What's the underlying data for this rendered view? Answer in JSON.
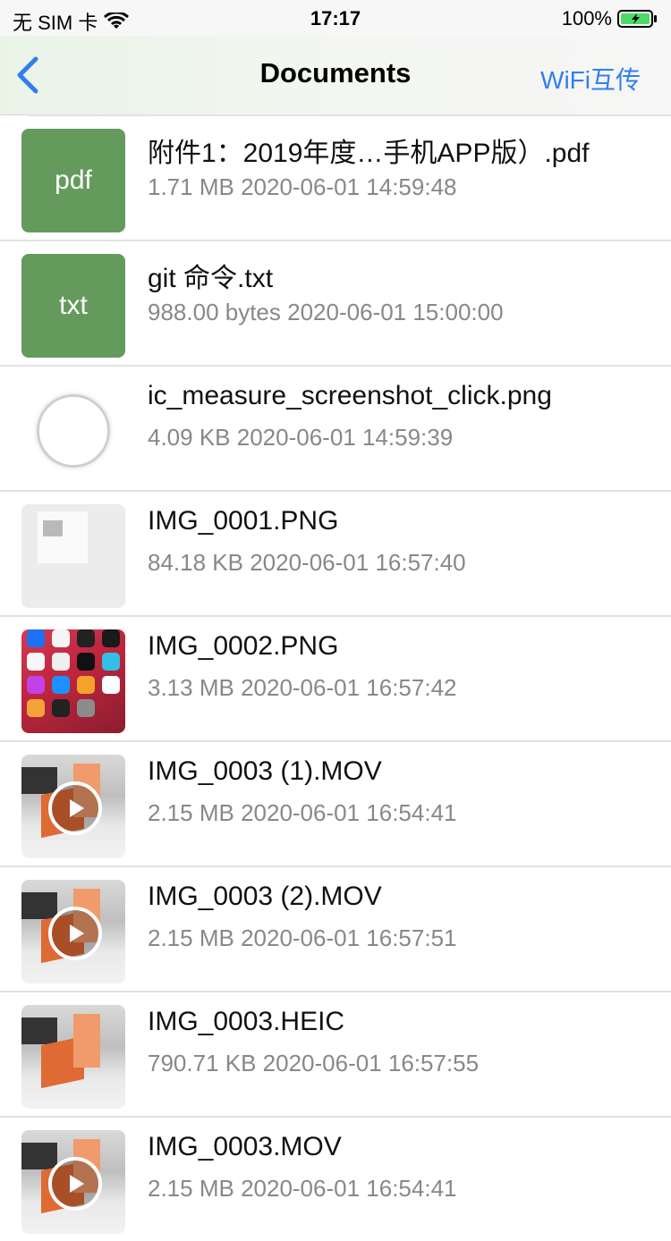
{
  "status_bar": {
    "carrier": "无 SIM 卡",
    "time": "17:17",
    "battery": "100%"
  },
  "nav": {
    "title": "Documents",
    "right_button": "WiFi互传",
    "accent_color": "#2f7ff0"
  },
  "files": [
    {
      "name": "附件1：2019年度…手机APP版）.pdf",
      "size": "1.71 MB",
      "date": "2020-06-01 14:59:48",
      "thumb_label": "pdf"
    },
    {
      "name": "git 命令.txt",
      "size": "988.00 bytes",
      "date": "2020-06-01 15:00:00",
      "thumb_label": "txt"
    },
    {
      "name": "ic_measure_screenshot_click.png",
      "size": "4.09 KB",
      "date": "2020-06-01 14:59:39"
    },
    {
      "name": "IMG_0001.PNG",
      "size": "84.18 KB",
      "date": "2020-06-01 16:57:40"
    },
    {
      "name": "IMG_0002.PNG",
      "size": "3.13 MB",
      "date": "2020-06-01 16:57:42"
    },
    {
      "name": "IMG_0003 (1).MOV",
      "size": "2.15 MB",
      "date": "2020-06-01 16:54:41"
    },
    {
      "name": "IMG_0003 (2).MOV",
      "size": "2.15 MB",
      "date": "2020-06-01 16:57:51"
    },
    {
      "name": "IMG_0003.HEIC",
      "size": "790.71 KB",
      "date": "2020-06-01 16:57:55"
    },
    {
      "name": "IMG_0003.MOV",
      "size": "2.15 MB",
      "date": "2020-06-01 16:54:41"
    }
  ]
}
